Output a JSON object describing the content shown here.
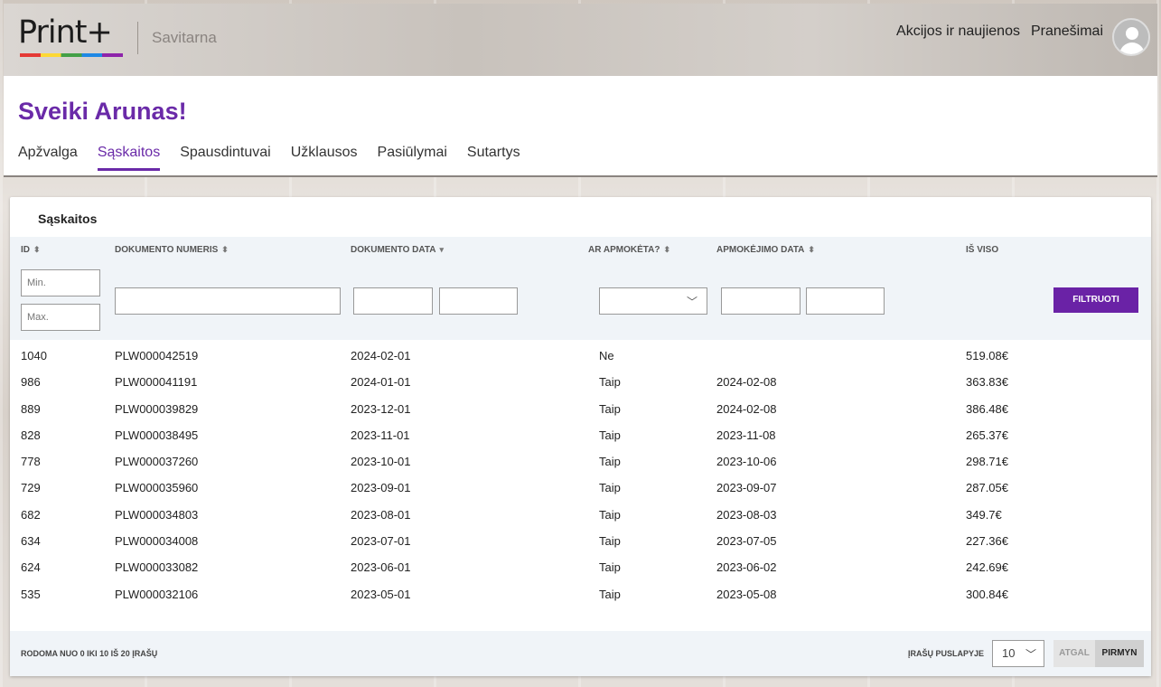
{
  "header": {
    "logo_text": "Print+",
    "app_name": "Savitarna",
    "nav": [
      "Akcijos ir naujienos",
      "Pranešimai"
    ]
  },
  "welcome": {
    "greeting": "Sveiki Arunas!",
    "tabs": [
      "Apžvalga",
      "Sąskaitos",
      "Spausdintuvai",
      "Užklausos",
      "Pasiūlymai",
      "Sutartys"
    ],
    "active_tab": "Sąskaitos"
  },
  "card": {
    "title": "Sąskaitos",
    "columns": [
      "ID",
      "DOKUMENTO NUMERIS",
      "DOKUMENTO DATA",
      "AR APMOKĖTA?",
      "APMOKĖJIMO DATA",
      "IŠ VISO"
    ],
    "filters": {
      "min_placeholder": "Min.",
      "max_placeholder": "Max.",
      "button": "FILTRUOTI"
    },
    "rows": [
      [
        "1040",
        "PLW000042519",
        "2024-02-01",
        "Ne",
        "",
        "519.08€"
      ],
      [
        "986",
        "PLW000041191",
        "2024-01-01",
        "Taip",
        "2024-02-08",
        "363.83€"
      ],
      [
        "889",
        "PLW000039829",
        "2023-12-01",
        "Taip",
        "2024-02-08",
        "386.48€"
      ],
      [
        "828",
        "PLW000038495",
        "2023-11-01",
        "Taip",
        "2023-11-08",
        "265.37€"
      ],
      [
        "778",
        "PLW000037260",
        "2023-10-01",
        "Taip",
        "2023-10-06",
        "298.71€"
      ],
      [
        "729",
        "PLW000035960",
        "2023-09-01",
        "Taip",
        "2023-09-07",
        "287.05€"
      ],
      [
        "682",
        "PLW000034803",
        "2023-08-01",
        "Taip",
        "2023-08-03",
        "349.7€"
      ],
      [
        "634",
        "PLW000034008",
        "2023-07-01",
        "Taip",
        "2023-07-05",
        "227.36€"
      ],
      [
        "624",
        "PLW000033082",
        "2023-06-01",
        "Taip",
        "2023-06-02",
        "242.69€"
      ],
      [
        "535",
        "PLW000032106",
        "2023-05-01",
        "Taip",
        "2023-05-08",
        "300.84€"
      ]
    ],
    "footer": {
      "info": "RODOMA NUO 0 IKI 10 IŠ 20 ĮRAŠŲ",
      "per_page_label": "ĮRAŠŲ PUSLAPYJE",
      "per_page_value": "10",
      "prev": "ATGAL",
      "next": "PIRMYN"
    }
  },
  "colors": {
    "accent": "#6a22a6"
  }
}
